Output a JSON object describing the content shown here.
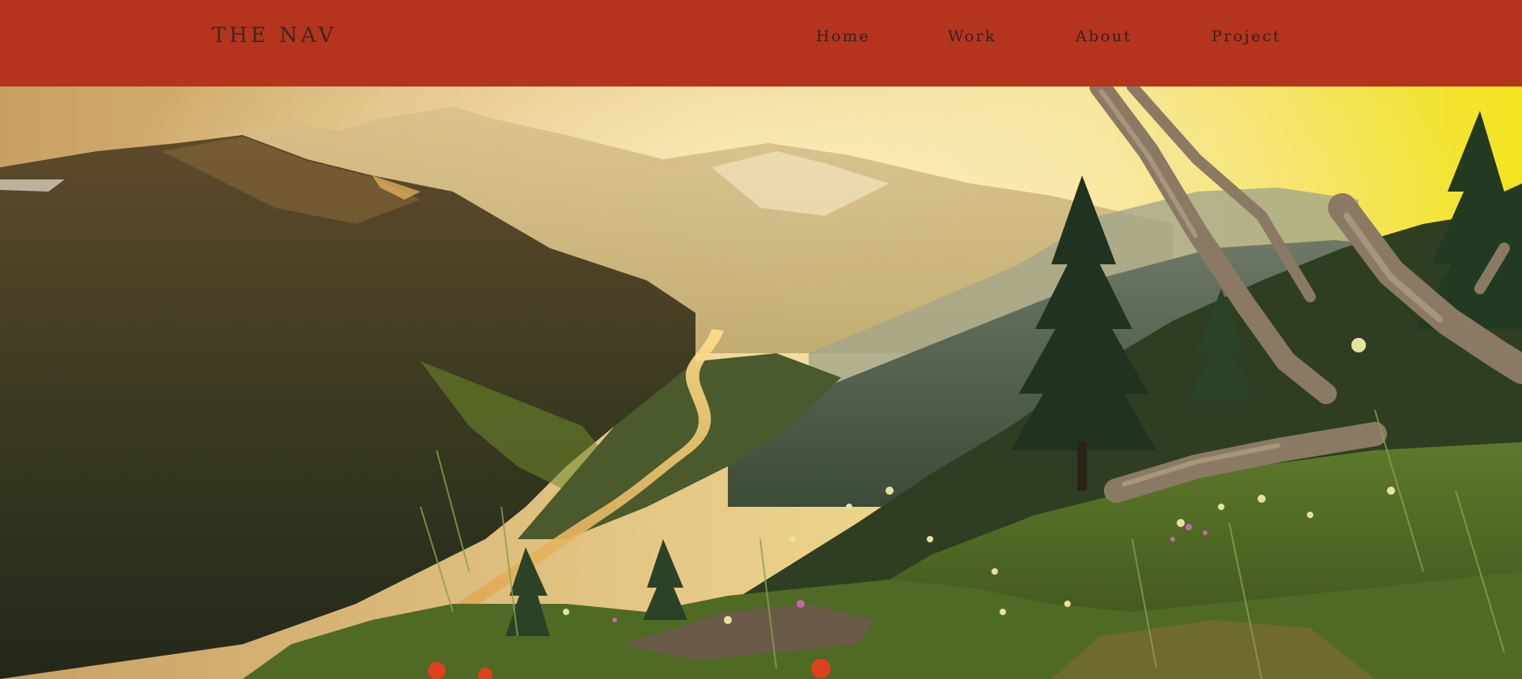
{
  "nav": {
    "brand": "THE NAV",
    "links": [
      "Home",
      "Work",
      "About",
      "Project"
    ],
    "background_color": "#b5341d",
    "text_color": "#2e2523"
  },
  "hero": {
    "image_subject": "mountain-valley-sunset-photo"
  }
}
